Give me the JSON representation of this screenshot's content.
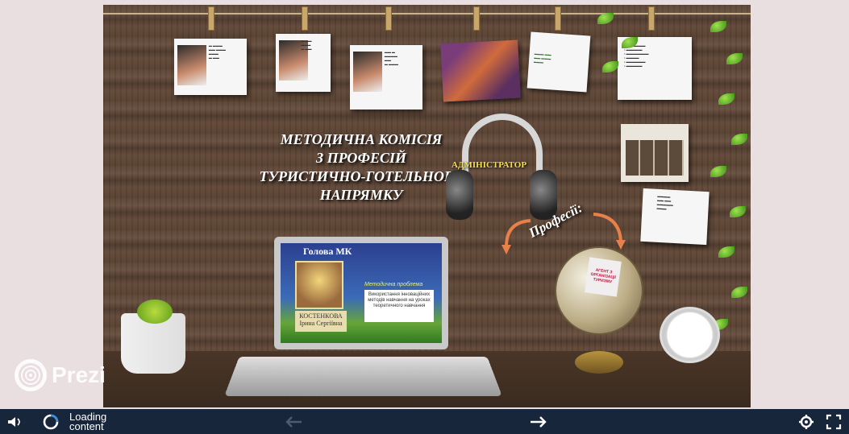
{
  "slide": {
    "title_lines": [
      "МЕТОДИЧНА КОМІСІЯ",
      "З ПРОФЕСІЙ",
      "ТУРИСТИЧНО-ГОТЕЛЬНОГО",
      "НАПРЯМКУ"
    ],
    "headphones_label": "АДМІНІСТРАТОР",
    "professions_label": "Професії:",
    "laptop": {
      "title": "Голова МК",
      "name_line1": "КОСТЕНКОВА",
      "name_line2": "Ірина Сергіївна",
      "problem_label": "Методична проблема",
      "problem_text": "Використання інноваційних методів навчання на уроках теоретичного навчання"
    },
    "globe_note": "АГЕНТ З ОРГАНІЗАЦІЇ ТУРИЗМУ",
    "logo_text": "Prezi"
  },
  "player": {
    "loading_line1": "Loading",
    "loading_line2": "content",
    "icons": {
      "volume": "volume-icon",
      "loading": "loading-spinner-icon",
      "prev": "arrow-left-icon",
      "next": "arrow-right-icon",
      "settings": "gear-icon",
      "fullscreen": "fullscreen-icon"
    }
  }
}
